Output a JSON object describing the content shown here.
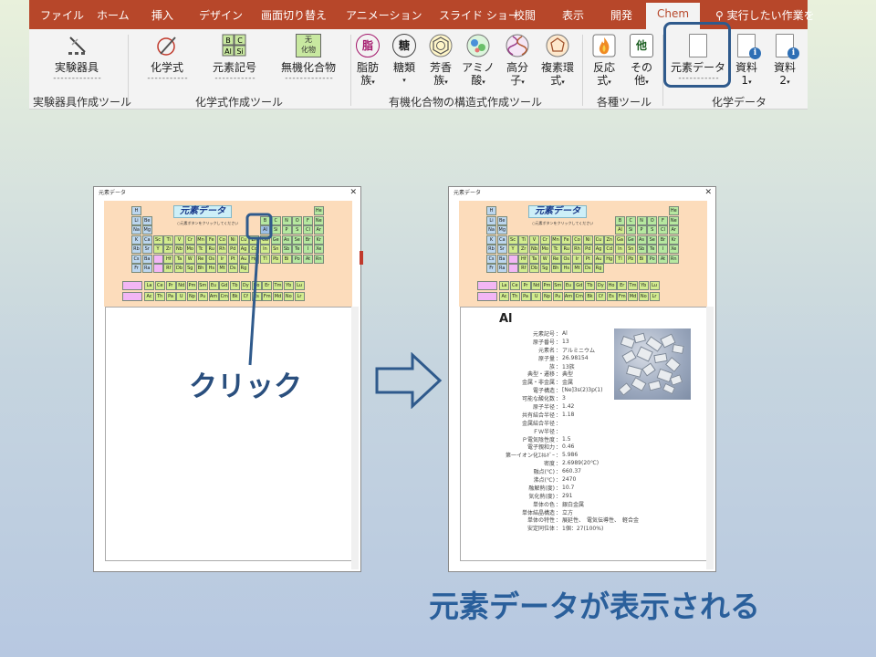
{
  "ribbon": {
    "tabs": [
      "ファイル",
      "ホーム",
      "挿入",
      "デザイン",
      "画面切り替え",
      "アニメーション",
      "スライド ショー",
      "校閲",
      "表示",
      "開発"
    ],
    "active_tab": "Chem",
    "tell_me": "実行したい作業を",
    "buttons": {
      "lab_equipment": "実験器具",
      "chemical_formula": "化学式",
      "element_symbol": "元素記号",
      "inorganic": "無機化合物",
      "fatty_l1": "脂肪",
      "fatty_l2": "族",
      "sugar": "糖類",
      "aromatic_l1": "芳香",
      "aromatic_l2": "族",
      "amino_l1": "アミノ",
      "amino_l2": "酸",
      "polymer_l1": "高分",
      "polymer_l2": "子",
      "heterocycle_l1": "複素環",
      "heterocycle_l2": "式",
      "reaction_l1": "反応",
      "reaction_l2": "式",
      "other_l1": "その",
      "other_l2": "他",
      "element_data": "元素データ",
      "material1_l1": "資料",
      "material1_l2": "1",
      "material2_l1": "資料",
      "material2_l2": "2"
    },
    "icons": {
      "fatty": "脂",
      "sugar": "糖",
      "other": "他",
      "inorganic_top": "无",
      "inorganic_bottom": "化物"
    },
    "groups": {
      "lab_tools": "実験器具作成ツール",
      "formula_tools": "化学式作成ツール",
      "organic_tools": "有機化合物の構造式作成ツール",
      "misc_tools": "各種ツール",
      "chem_data": "化学データ"
    }
  },
  "left_window": {
    "title": "元素データ",
    "table_title": "元素データ",
    "hint": "○元素ボタンをクリックしてください"
  },
  "right_window": {
    "title": "元素データ",
    "table_title": "元素データ",
    "hint": "○元素ボタンをクリックしてください",
    "element_symbol": "Al",
    "properties": [
      {
        "k": "元素記号",
        "v": "Al"
      },
      {
        "k": "原子番号",
        "v": "13"
      },
      {
        "k": "元素名",
        "v": "アルミニウム"
      },
      {
        "k": "原子量",
        "v": "26.98154"
      },
      {
        "k": "族",
        "v": "13族"
      },
      {
        "k": "典型・遷移",
        "v": "典型"
      },
      {
        "k": "金属・非金属",
        "v": "金属"
      },
      {
        "k": "電子構造",
        "v": "[Ne]3s(2)3p(1)"
      },
      {
        "k": "可能な酸化数",
        "v": "3"
      },
      {
        "k": "原子半径",
        "v": "1.42"
      },
      {
        "k": "共有結合半径",
        "v": "1.18"
      },
      {
        "k": "金属結合半径",
        "v": ""
      },
      {
        "k": "ＦＷ半径",
        "v": ""
      },
      {
        "k": "Ｐ電気陰性度",
        "v": "1.5"
      },
      {
        "k": "電子親和力",
        "v": "0.46"
      },
      {
        "k": "第一イオン化ｴﾈﾙｷﾞｰ",
        "v": "5.986"
      },
      {
        "k": "密度",
        "v": "2.6989(20℃)"
      },
      {
        "k": "融点(℃)",
        "v": "660.37"
      },
      {
        "k": "沸点(℃)",
        "v": "2470"
      },
      {
        "k": "融解熱(度)",
        "v": "10.7"
      },
      {
        "k": "気化熱(度)",
        "v": "291"
      },
      {
        "k": "単体の色",
        "v": "銀白金属"
      },
      {
        "k": "単体結晶構造",
        "v": "立方"
      },
      {
        "k": "単体の特性",
        "v": "展延性、　電気伝導性、　軽合金"
      },
      {
        "k": "安定同位体",
        "v": "1個：27(100%)"
      }
    ]
  },
  "periodic_table": {
    "rows": [
      [
        "H",
        "",
        "",
        "",
        "",
        "",
        "",
        "",
        "",
        "",
        "",
        "",
        "",
        "",
        "",
        "",
        "",
        "He"
      ],
      [
        "Li",
        "Be",
        "",
        "",
        "",
        "",
        "",
        "",
        "",
        "",
        "",
        "",
        "B",
        "C",
        "N",
        "O",
        "F",
        "Ne"
      ],
      [
        "Na",
        "Mg",
        "",
        "",
        "",
        "",
        "",
        "",
        "",
        "",
        "",
        "",
        "Al",
        "Si",
        "P",
        "S",
        "Cl",
        "Ar"
      ],
      [
        "K",
        "Ca",
        "Sc",
        "Ti",
        "V",
        "Cr",
        "Mn",
        "Fe",
        "Co",
        "Ni",
        "Cu",
        "Zn",
        "Ga",
        "Ge",
        "As",
        "Se",
        "Br",
        "Kr"
      ],
      [
        "Rb",
        "Sr",
        "Y",
        "Zr",
        "Nb",
        "Mo",
        "Tc",
        "Ru",
        "Rh",
        "Pd",
        "Ag",
        "Cd",
        "In",
        "Sn",
        "Sb",
        "Te",
        "I",
        "Xe"
      ],
      [
        "Cs",
        "Ba",
        "",
        "Hf",
        "Ta",
        "W",
        "Re",
        "Os",
        "Ir",
        "Pt",
        "Au",
        "Hg",
        "Tl",
        "Pb",
        "Bi",
        "Po",
        "At",
        "Rn"
      ],
      [
        "Fr",
        "Ra",
        "",
        "Rf",
        "Db",
        "Sg",
        "Bh",
        "Hs",
        "Mt",
        "Ds",
        "Rg",
        "",
        "",
        "",
        "",
        "",
        "",
        ""
      ]
    ],
    "lanthanides": [
      "La",
      "Ce",
      "Pr",
      "Nd",
      "Pm",
      "Sm",
      "Eu",
      "Gd",
      "Tb",
      "Dy",
      "Ho",
      "Er",
      "Tm",
      "Yb",
      "Lu"
    ],
    "actinides": [
      "Ac",
      "Th",
      "Pa",
      "U",
      "Np",
      "Pu",
      "Am",
      "Cm",
      "Bk",
      "Cf",
      "Es",
      "Fm",
      "Md",
      "No",
      "Lr"
    ]
  },
  "annotations": {
    "click": "クリック",
    "caption": "元素データが表示される"
  },
  "colors": {
    "accent": "#b7472a",
    "highlight": "#2f5a8c",
    "metal_cell": "#d2ec8e",
    "nonmetal_cell": "#b6e8a0",
    "alkali_cell": "#bcd6ee",
    "lanthanide_label": "#f2b6f5",
    "table_bg": "#fcdcbb"
  }
}
